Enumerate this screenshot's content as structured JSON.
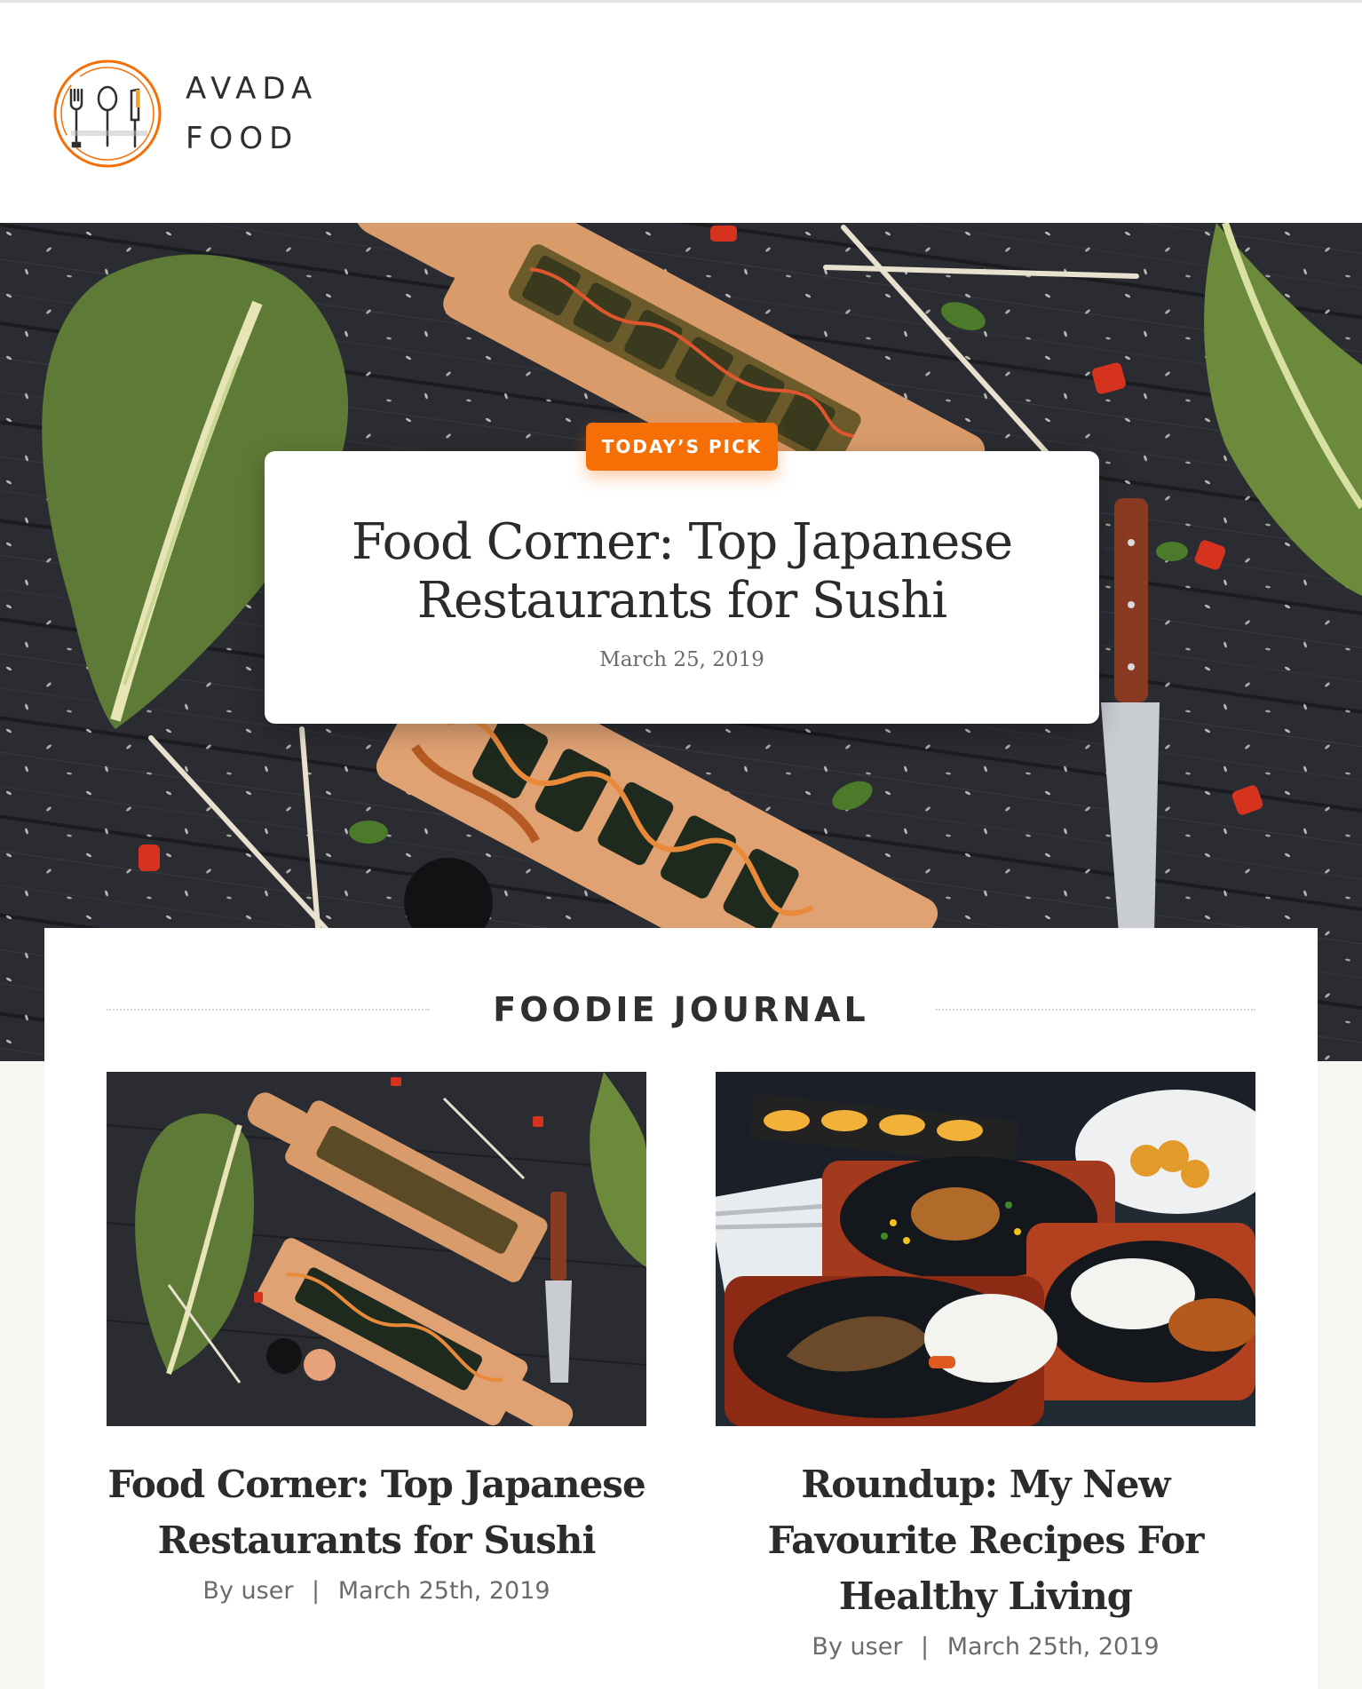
{
  "brand": {
    "line1": "AVADA",
    "line2": "FOOD",
    "accent_color": "#f66f06",
    "logo_icon": "cutlery-icon"
  },
  "hero": {
    "badge": "TODAY’S PICK",
    "title_line1": "Food Corner: Top Japanese",
    "title_line2": "Restaurants for Sushi",
    "date": "March 25, 2019",
    "image_icon": "sushi-board-photo"
  },
  "journal": {
    "heading": "FOODIE JOURNAL",
    "posts": [
      {
        "title_line1": "Food Corner: Top Japanese",
        "title_line2": "Restaurants for Sushi",
        "title_line3": "",
        "by_label": "By",
        "author": "user",
        "date": "March 25th, 2019",
        "image_icon": "sushi-board-photo"
      },
      {
        "title_line1": "Roundup: My New",
        "title_line2": "Favourite Recipes For",
        "title_line3": "Healthy Living",
        "by_label": "By",
        "author": "user",
        "date": "March 25th, 2019",
        "image_icon": "sizzling-plates-photo"
      }
    ]
  }
}
